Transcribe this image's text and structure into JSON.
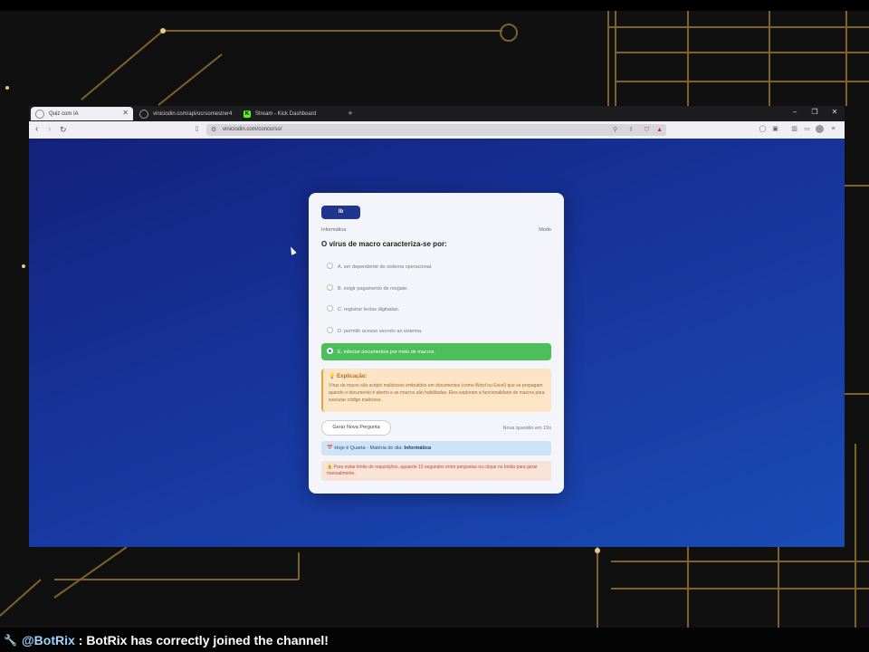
{
  "browser": {
    "tabs": [
      {
        "title": "Quiz com IA",
        "favicon": "globe-icon",
        "active": true
      },
      {
        "title": "viniciodin.com/api/ocrsomestrer4",
        "favicon": "globe-icon",
        "active": false
      },
      {
        "title": "Stream - Kick Dashboard",
        "favicon": "kick-logo-icon",
        "active": false
      }
    ],
    "new_tab_label": "+",
    "window_controls": {
      "minimize": "–",
      "maximize": "❐",
      "close": "✕"
    },
    "nav": {
      "back": "‹",
      "forward": "›",
      "reload": "↻"
    },
    "url": "viniciodin.com/concurso/"
  },
  "quiz": {
    "tag": "Ib",
    "category": "Informática",
    "mode": "Modo",
    "question": "O vírus de macro caracteriza-se por:",
    "options": [
      {
        "label": "A. ser dependente do sistema operacional.",
        "correct": false
      },
      {
        "label": "B. exigir pagamento de resgate.",
        "correct": false
      },
      {
        "label": "C. registrar teclas digitadas.",
        "correct": false
      },
      {
        "label": "D. permitir acesso secreto ao sistema.",
        "correct": false
      },
      {
        "label": "E. infectar documentos por meio de macros.",
        "correct": true
      }
    ],
    "explanation": {
      "title": "💡 Explicação:",
      "text": "Vírus de macro são scripts maliciosos embutidos em documentos (como Word ou Excel) que se propagam quando o documento é aberto e as macros são habilitadas. Eles exploram a funcionalidade de macros para executar código malicioso."
    },
    "new_question_button": "Gerar Nova Pergunta",
    "next_question_timer": "Nova questão em 19s",
    "daily_prefix": "📅 Hoje é Quarta - Matéria do dia:",
    "daily_subject": "Informática",
    "warning": "⚠️ Para evitar limite de requisições, aguarde 10 segundos entre perguntas ou clique no botão para gerar manualmente."
  },
  "chat": {
    "username": "@BotRix",
    "message": ": BotRix has correctly joined the channel!"
  },
  "colors": {
    "card_background": "#f4f5fa",
    "correct_option": "#4cbf5a",
    "tag_pill": "#1f3590",
    "viewport_gradient_start": "#13217a",
    "viewport_gradient_end": "#1a4bb5"
  }
}
